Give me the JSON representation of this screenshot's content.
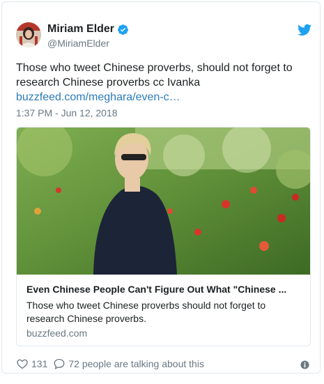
{
  "author": {
    "name": "Miriam Elder",
    "handle": "@MiriamElder"
  },
  "tweet": {
    "text": "Those who tweet Chinese proverbs, should not forget to research Chinese proverbs cc Ivanka",
    "link": "buzzfeed.com/meghara/even-c…",
    "timestamp": "1:37 PM - Jun 12, 2018"
  },
  "card": {
    "title": "Even Chinese People Can't Figure Out What \"Chinese ...",
    "description": "Those who tweet Chinese proverbs should not forget to research Chinese proverbs.",
    "domain": "buzzfeed.com"
  },
  "actions": {
    "likes": "131",
    "conversation": "72 people are talking about this"
  },
  "icons": {
    "verified": "verified-badge-icon",
    "twitter": "twitter-bird-icon",
    "like": "heart-icon",
    "reply": "speech-bubble-icon",
    "info": "info-icon"
  },
  "colors": {
    "link": "#2b7bb9",
    "secondary_text": "#697882",
    "twitter_blue": "#1da1f2",
    "border": "#e1e8ed"
  }
}
